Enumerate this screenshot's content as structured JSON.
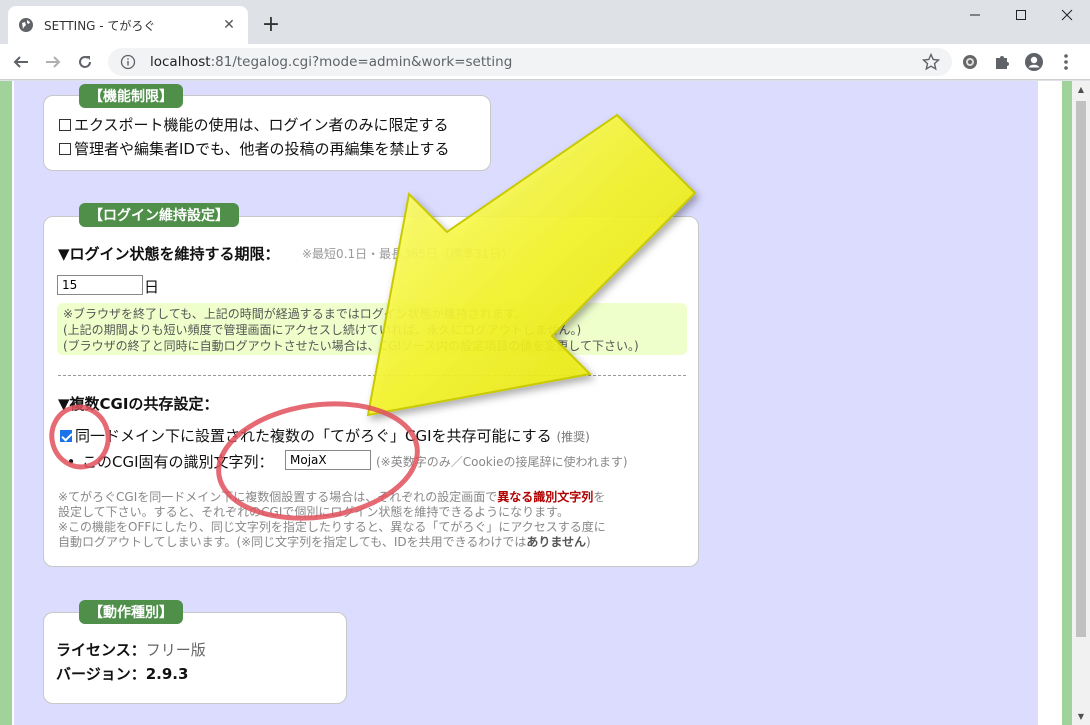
{
  "browser": {
    "tab_title": "SETTING - てがろぐ",
    "url_host": "localhost",
    "url_rest": ":81/tegalog.cgi?mode=admin&work=setting"
  },
  "sections": {
    "function_restriction": {
      "legend": "【機能制限】",
      "items": [
        {
          "label": "エクスポート機能の使用は、ログイン者のみに限定する",
          "checked": false
        },
        {
          "label": "管理者や編集者IDでも、他者の投稿の再編集を禁止する",
          "checked": false
        }
      ]
    },
    "login_keep": {
      "legend": "【ログイン維持設定】",
      "period_heading": "▼ログイン状態を維持する期限：",
      "period_hint": "※最短0.1日・最長365日（標準31日）",
      "period_value": "15",
      "period_unit": "日",
      "note_lines": [
        "※ブラウザを終了しても、上記の時間が経過するまではログイン状態が維持されます。",
        "(上記の期間よりも短い頻度で管理画面にアクセスし続けていれば、永久にログアウトしません。)",
        "(ブラウザの終了と同時に自動ログアウトさせたい場合は、CGIソース内の設定項目の値を変更して下さい。)"
      ],
      "multi_heading": "▼複数CGIの共存設定：",
      "share_label": "同一ドメイン下に設置された複数の「てがろぐ」CGIを共存可能にする",
      "share_recommend": "(推奨)",
      "share_checked": true,
      "id_label": "このCGI固有の識別文字列：",
      "id_value": "MojaX",
      "id_hint": "(※英数字のみ／Cookieの接尾辞に使われます)",
      "explain_1a": "※てがろぐCGIを同一ドメイン下に複数個設置する場合は、それぞれの設定画面で",
      "explain_1b": "異なる識別文字列",
      "explain_1c": "を",
      "explain_2": "設定して下さい。すると、それぞれのCGIで個別にログイン状態を維持できるようになります。",
      "explain_3": "※この機能をOFFにしたり、同じ文字列を指定したりすると、異なる「てがろぐ」にアクセスする度に",
      "explain_4a": "自動ログアウトしてしまいます。(※同じ文字列を指定しても、IDを共用できるわけでは",
      "explain_4b": "ありません",
      "explain_4c": ")"
    },
    "operation_type": {
      "legend": "【動作種別】",
      "license_label": "ライセンス：",
      "license_value": "フリー版",
      "version_label": "バージョン：",
      "version_value": "2.9.3"
    }
  },
  "colors": {
    "legend_bg": "#4f8f4a",
    "page_bg": "#dcdcff",
    "note_bg": "#efffcc",
    "highlight": "#b00000",
    "arrow": "#f5f52a",
    "circle": "#e0505a"
  }
}
